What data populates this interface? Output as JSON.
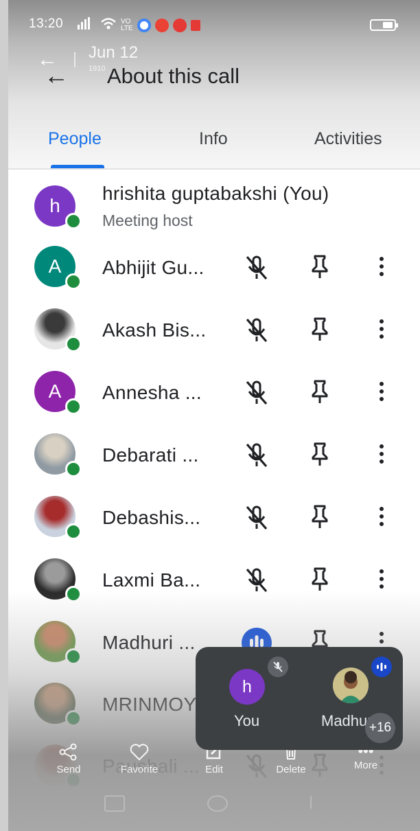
{
  "status_bar": {
    "time": "13:20"
  },
  "overlay": {
    "date": "Jun 12",
    "small_text": "1910"
  },
  "header": {
    "title": "About this call"
  },
  "tabs": [
    {
      "label": "People",
      "active": true
    },
    {
      "label": "Info",
      "active": false
    },
    {
      "label": "Activities",
      "active": false
    }
  ],
  "host": {
    "initial": "h",
    "name": "hrishita guptabakshi (You)",
    "role": "Meeting host",
    "color": "#7b38c5"
  },
  "participants": [
    {
      "name": "Abhijit Gu...",
      "avatar_type": "initial",
      "initial": "A",
      "color": "#00897b",
      "mic": "muted"
    },
    {
      "name": "Akash Bis...",
      "avatar_type": "photo",
      "mic": "muted"
    },
    {
      "name": "Annesha ...",
      "avatar_type": "initial",
      "initial": "A",
      "color": "#8e24aa",
      "mic": "muted"
    },
    {
      "name": "Debarati ...",
      "avatar_type": "photo",
      "mic": "muted"
    },
    {
      "name": "Debashis...",
      "avatar_type": "photo",
      "mic": "muted"
    },
    {
      "name": "Laxmi Ba...",
      "avatar_type": "photo",
      "mic": "muted"
    },
    {
      "name": "Madhuri ...",
      "avatar_type": "photo",
      "mic": "speaking"
    },
    {
      "name": "MRINMOY",
      "avatar_type": "photo",
      "mic": "none"
    },
    {
      "name": "Paushali ...",
      "avatar_type": "photo",
      "mic": "muted"
    }
  ],
  "gallery_overlay": [
    "Send",
    "Favorite",
    "Edit",
    "Delete",
    "More"
  ],
  "pip": {
    "self_initial": "h",
    "self_label": "You",
    "other_label": "Madhuri",
    "extra_count": "+16"
  },
  "colors": {
    "accent": "#1a73e8",
    "presence": "#1e8e3e",
    "pip_bg": "#3c4043"
  }
}
